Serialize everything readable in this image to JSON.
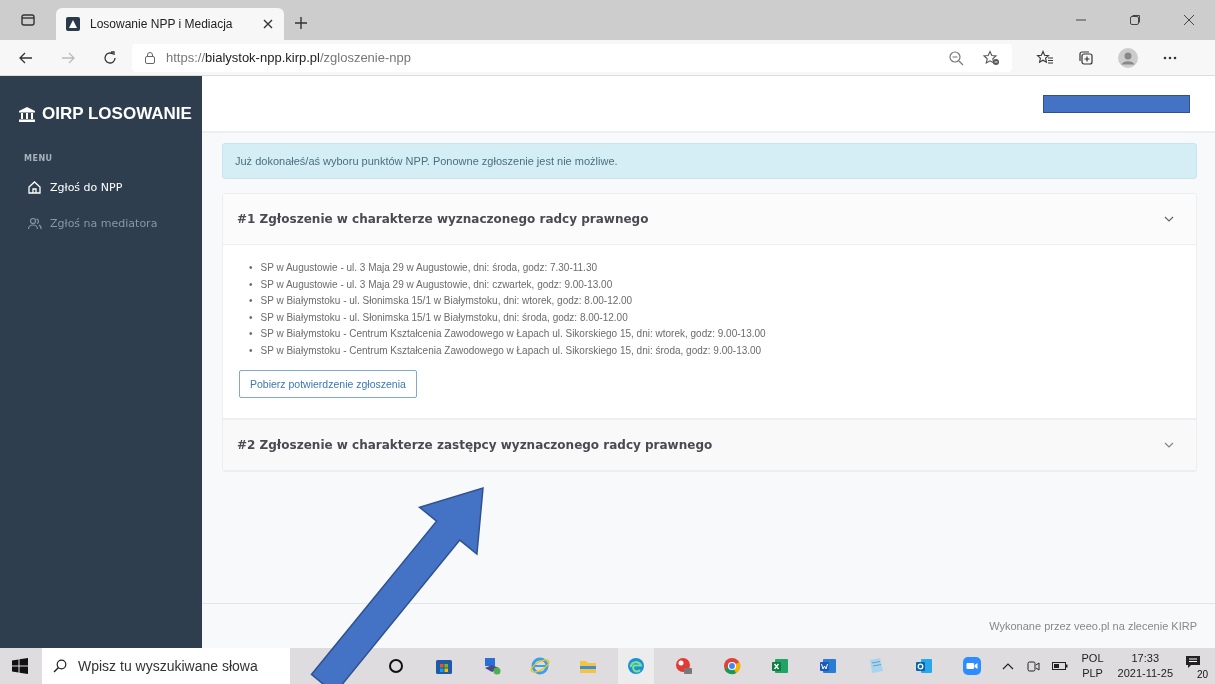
{
  "browser": {
    "tab": {
      "title": "Losowanie NPP i Mediacja"
    },
    "address": {
      "scheme": "https://",
      "host": "bialystok-npp.kirp.pl",
      "path": "/zgloszenie-npp"
    }
  },
  "sidebar": {
    "brand": "OIRP LOSOWANIE",
    "section": "MENU",
    "items": [
      {
        "label": "Zgłoś do NPP",
        "selected": true
      },
      {
        "label": "Zgłoś na mediatora",
        "selected": false
      }
    ]
  },
  "alert": "Już dokonałeś/aś wyboru punktów NPP. Ponowne zgłoszenie jest nie możliwe.",
  "sections": [
    {
      "title": "#1 Zgłoszenie w charakterze wyznaczonego radcy prawnego",
      "expanded": true,
      "items": [
        {
          "marker": "•",
          "text": "SP w Augustowie - ul. 3 Maja 29 w Augustowie, dni: środa, godz: 7.30-11.30"
        },
        {
          "marker": "•",
          "text": "SP w Augustowie - ul. 3 Maja 29 w Augustowie, dni: czwartek, godz: 9.00-13.00"
        },
        {
          "marker": "•",
          "text": "SP w Białymstoku - ul. Słonimska 15/1 w Białymstoku, dni: wtorek, godz: 8.00-12.00"
        },
        {
          "marker": "•",
          "text": "SP w Białymstoku - ul. Słonimska 15/1 w Białymstoku, dni: środa, godz: 8.00-12.00"
        },
        {
          "marker": "•",
          "text": "SP w Białymstoku - Centrum Kształcenia Zawodowego w Łapach ul. Sikorskiego 15, dni: wtorek, godz: 9.00-13.00"
        },
        {
          "marker": "•",
          "text": "SP w Białymstoku - Centrum Kształcenia Zawodowego w Łapach ul. Sikorskiego 15, dni: środa, godz: 9.00-13.00"
        }
      ],
      "button": "Pobierz potwierdzenie zgłoszenia"
    },
    {
      "title": "#2 Zgłoszenie w charakterze zastępcy wyznaczonego radcy prawnego",
      "expanded": false
    }
  ],
  "footer": "Wykonane przez veeo.pl na zlecenie KIRP",
  "taskbar": {
    "search_placeholder": "Wpisz tu wyszukiwane słowa",
    "language": "POL",
    "layout": "PLP",
    "time": "17:33",
    "date": "2021-11-25",
    "notifications": "20"
  }
}
